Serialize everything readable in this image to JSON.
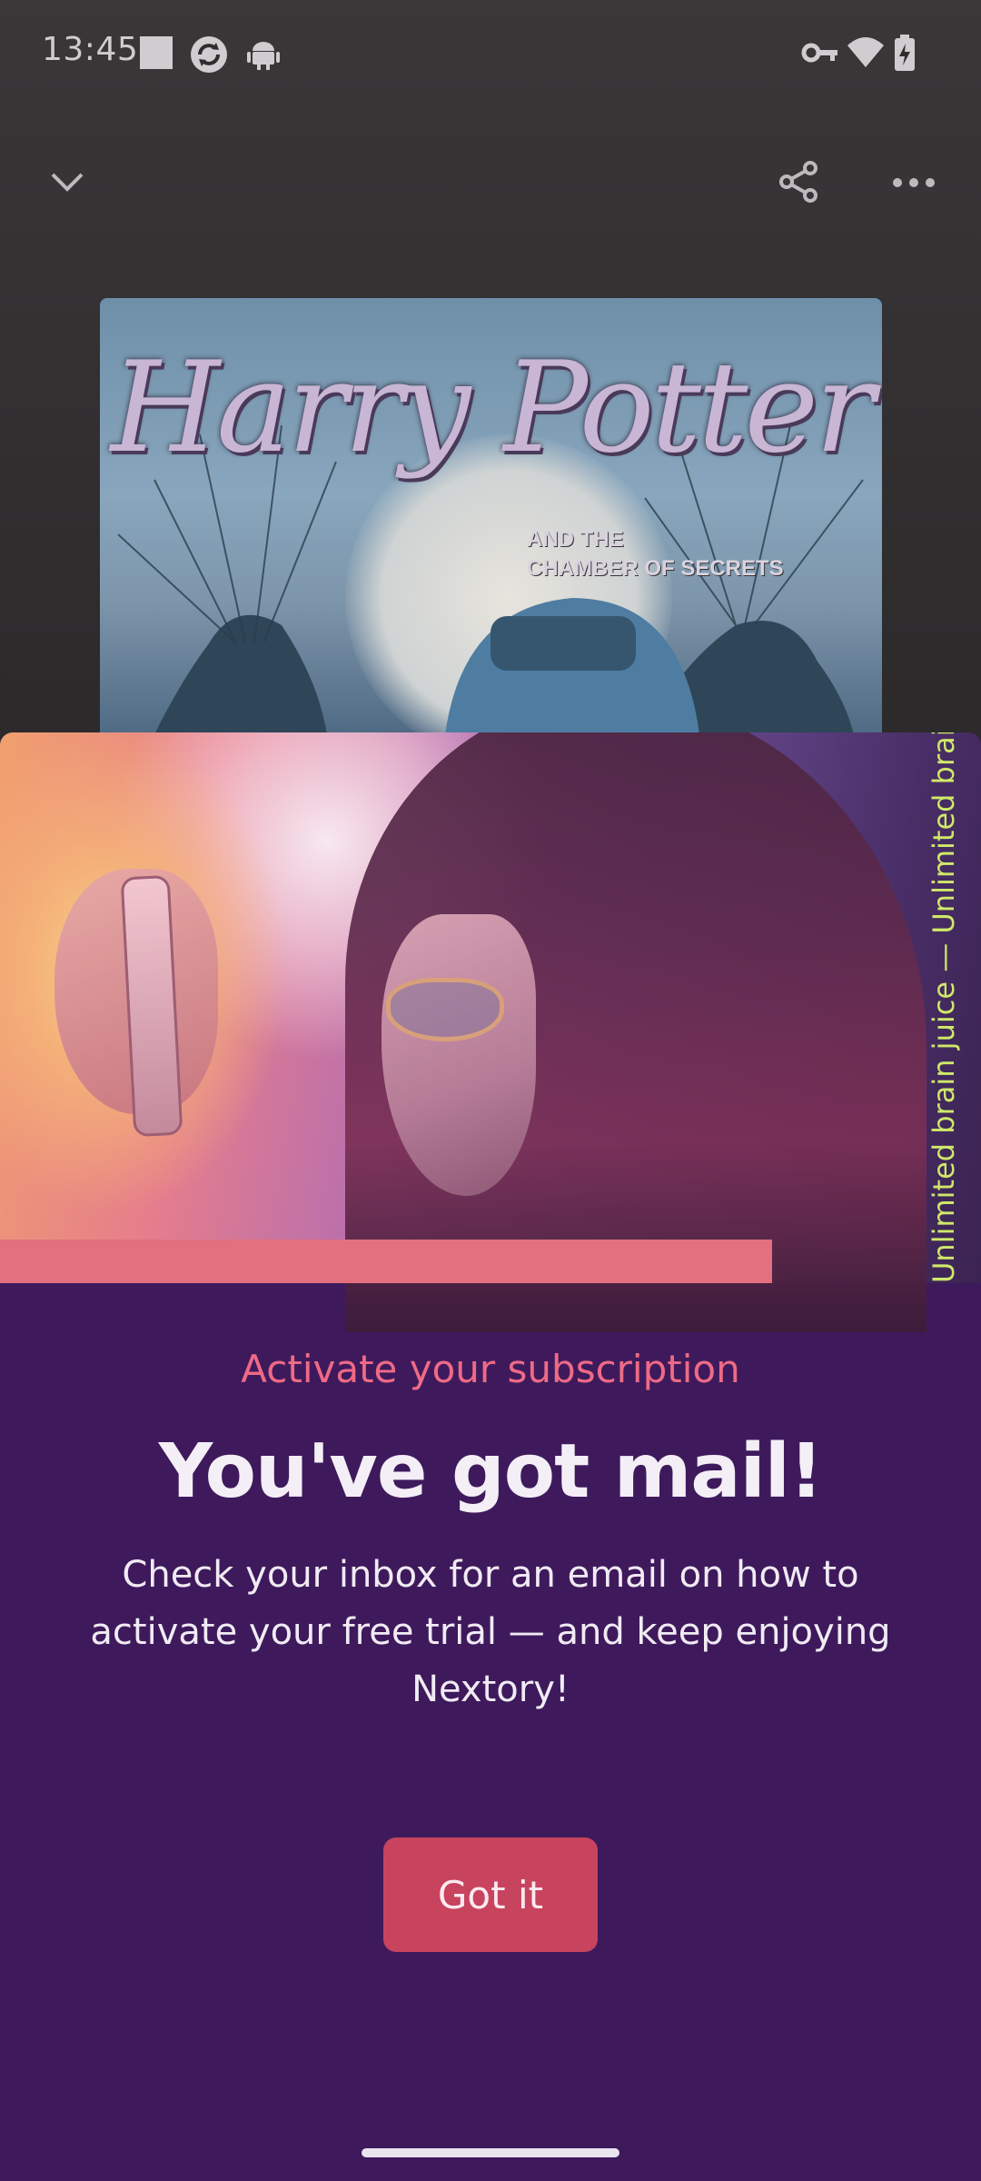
{
  "status_bar": {
    "time": "13:45",
    "left_icons": [
      "stop-square-icon",
      "sync-circle-icon",
      "android-icon"
    ],
    "right_icons": [
      "vpn-key-icon",
      "wifi-icon",
      "battery-charging-icon"
    ]
  },
  "app_bar": {
    "icons": [
      "chevron-down-icon",
      "share-icon",
      "more-horizontal-icon"
    ]
  },
  "book_cover": {
    "title": "Harry Potter",
    "subtitle_line1": "AND THE",
    "subtitle_line2": "CHAMBER OF SECRETS"
  },
  "modal": {
    "hero_tagline": "Unlimited brain juice — Unlimited brain juice — Unlimited brain",
    "eyebrow": "Activate your subscription",
    "headline": "You've got mail!",
    "body": "Check your inbox for an email on how to activate your free trial — and keep enjoying Nextory!",
    "button_label": "Got it"
  },
  "colors": {
    "sheet_background": "#3e1a5c",
    "eyebrow": "#ef6a86",
    "button": "#c8435e",
    "tagline": "#cfe86a"
  }
}
